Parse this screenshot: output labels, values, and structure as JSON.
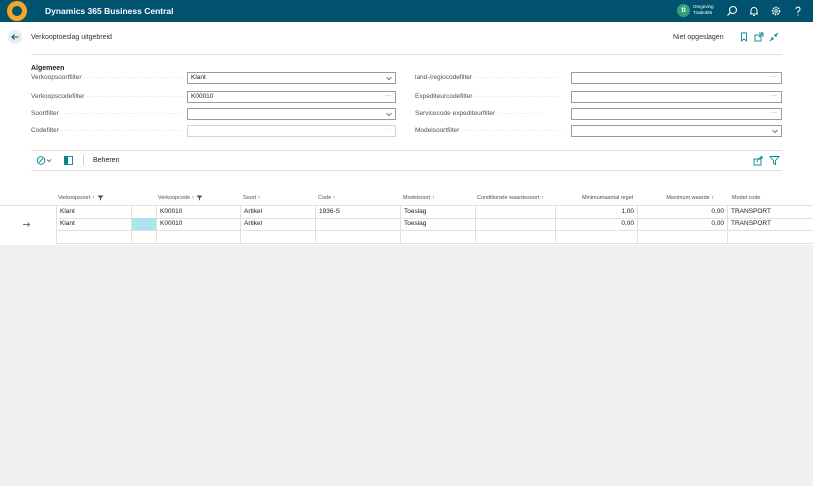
{
  "topbar": {
    "app_title": "Dynamics 365 Business Central",
    "env_badge": "ti",
    "env_line1": "Omgeving",
    "env_line2": "Trade365"
  },
  "page": {
    "title": "Verkooptoeslag uitgebreid",
    "save_status": "Niet opgeslagen"
  },
  "general": {
    "section_title": "Algemeen",
    "left_fields": [
      {
        "label": "Verkoopsoortfilter",
        "value": "Klant",
        "control": "dropdown"
      },
      {
        "label": "Verkoopscodefilter",
        "value": "K00010",
        "control": "lookup"
      },
      {
        "label": "Soortfilter",
        "value": "",
        "control": "dropdown"
      },
      {
        "label": "Codefilter",
        "value": "",
        "control": "lookup-disabled"
      }
    ],
    "right_fields": [
      {
        "label": "land-/regiocodefilter",
        "value": "",
        "control": "lookup"
      },
      {
        "label": "Expediteurcodefilter",
        "value": "",
        "control": "lookup"
      },
      {
        "label": "Servicecode expediteurfilter",
        "value": "",
        "control": "lookup"
      },
      {
        "label": "Modelsoortfilter",
        "value": "",
        "control": "dropdown"
      }
    ]
  },
  "actions": {
    "manage_label": "Beheren"
  },
  "grid": {
    "columns": [
      {
        "label": "Verkoopsoort ↑",
        "filter": true
      },
      {
        "label": "Verkoopcode ↑",
        "filter": true
      },
      {
        "label": "Soort ↑",
        "filter": false
      },
      {
        "label": "Code ↑",
        "filter": false
      },
      {
        "label": "Modelsoort ↑",
        "filter": false
      },
      {
        "label": "Conditionele waardesoort ↑",
        "filter": false
      },
      {
        "label": "Minimumaantal regel",
        "filter": false
      },
      {
        "label": "Maximum waarde ↑",
        "filter": false
      },
      {
        "label": "Model code",
        "filter": false
      }
    ],
    "rows": [
      [
        "Klant",
        "",
        "K00010",
        "Artikel",
        "1936-S",
        "Toeslag",
        "",
        "1,00",
        "0,00",
        "TRANSPORT"
      ],
      [
        "Klant",
        "",
        "K00010",
        "Artikel",
        "",
        "Toeslag",
        "",
        "0,00",
        "0,00",
        "TRANSPORT"
      ]
    ]
  },
  "icons": {
    "logo": "dynamics-logo-icon",
    "search": "search-icon",
    "notifications": "bell-icon",
    "settings": "gear-icon",
    "help": "question-icon",
    "back": "arrow-left-icon",
    "bookmark": "bookmark-icon",
    "open_new": "open-new-window-icon",
    "collapse": "collapse-icon",
    "share": "share-icon",
    "filter": "filter-icon",
    "row_marker": "arrow-right-icon"
  },
  "colors": {
    "topbar": "#00526e",
    "accent": "#008489",
    "selected_cell": "#a8e6ec"
  }
}
